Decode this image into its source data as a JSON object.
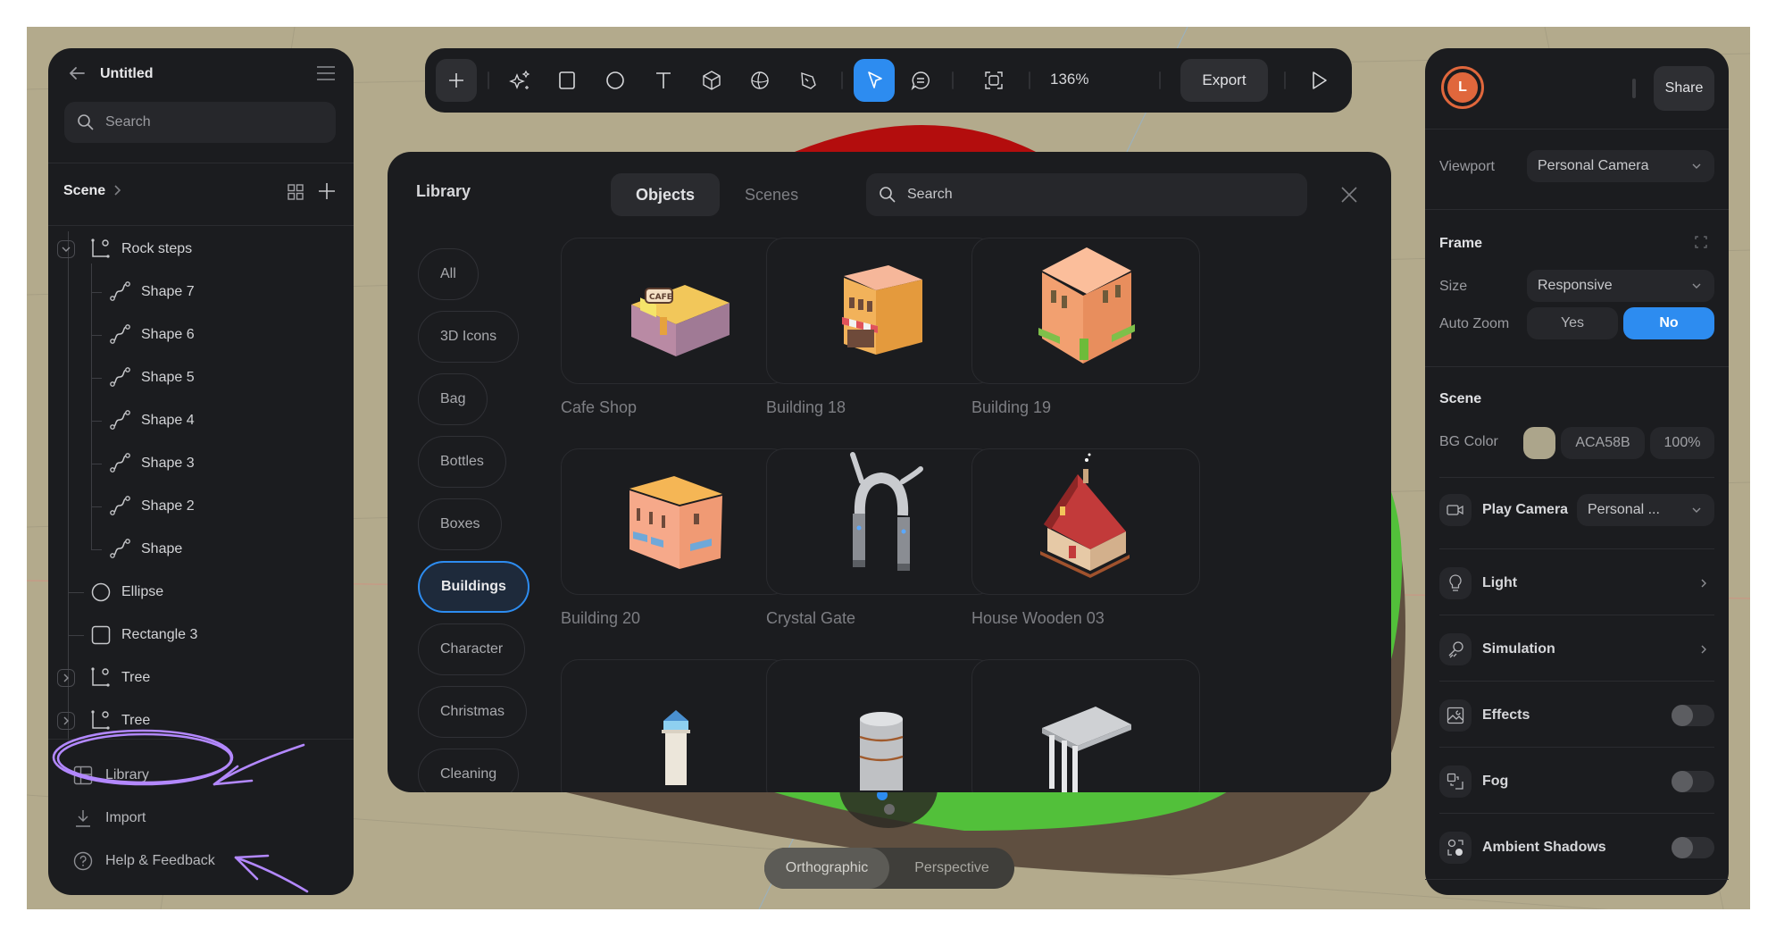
{
  "document": {
    "title": "Untitled"
  },
  "left_panel": {
    "search_placeholder": "Search",
    "scene_label": "Scene",
    "tree": [
      {
        "label": "Rock steps",
        "icon": "group-icon",
        "depth": 0,
        "toggle": "expanded"
      },
      {
        "label": "Shape 7",
        "icon": "path-shape-icon",
        "depth": 1
      },
      {
        "label": "Shape 6",
        "icon": "path-shape-icon",
        "depth": 1
      },
      {
        "label": "Shape 5",
        "icon": "path-shape-icon",
        "depth": 1
      },
      {
        "label": "Shape 4",
        "icon": "path-shape-icon",
        "depth": 1
      },
      {
        "label": "Shape 3",
        "icon": "path-shape-icon",
        "depth": 1
      },
      {
        "label": "Shape 2",
        "icon": "path-shape-icon",
        "depth": 1
      },
      {
        "label": "Shape",
        "icon": "path-shape-icon",
        "depth": 1
      },
      {
        "label": "Ellipse",
        "icon": "ellipse-icon",
        "depth": 0
      },
      {
        "label": "Rectangle 3",
        "icon": "rectangle-icon",
        "depth": 0
      },
      {
        "label": "Tree",
        "icon": "group-icon",
        "depth": 0,
        "toggle": "collapsed"
      },
      {
        "label": "Tree",
        "icon": "group-icon",
        "depth": 0,
        "toggle": "collapsed"
      }
    ],
    "footer": [
      {
        "label": "Library",
        "icon": "library-icon"
      },
      {
        "label": "Import",
        "icon": "import-icon"
      },
      {
        "label": "Help & Feedback",
        "icon": "help-icon"
      }
    ],
    "annotation": {
      "color": "#b388ff",
      "target": "Library"
    }
  },
  "toolbar": {
    "tools": [
      {
        "name": "add",
        "icon": "plus-icon"
      },
      {
        "name": "ai-generate",
        "icon": "sparkles-icon"
      },
      {
        "name": "rectangle",
        "icon": "rectangle-icon"
      },
      {
        "name": "ellipse",
        "icon": "ellipse-icon"
      },
      {
        "name": "text",
        "icon": "text-icon"
      },
      {
        "name": "cube",
        "icon": "cube-icon"
      },
      {
        "name": "sphere",
        "icon": "sphere-icon"
      },
      {
        "name": "pen",
        "icon": "pen-icon"
      },
      {
        "name": "select",
        "icon": "pointer-icon",
        "active": true
      },
      {
        "name": "comment",
        "icon": "comment-icon"
      },
      {
        "name": "frame",
        "icon": "frame-icon"
      }
    ],
    "zoom": "136%",
    "export_label": "Export",
    "play_icon": "play-icon",
    "accent": "#2d8cf0"
  },
  "library": {
    "title": "Library",
    "tabs": [
      {
        "label": "Objects",
        "active": true
      },
      {
        "label": "Scenes",
        "active": false
      }
    ],
    "search_placeholder": "Search",
    "categories": [
      {
        "label": "All"
      },
      {
        "label": "3D Icons"
      },
      {
        "label": "Bag"
      },
      {
        "label": "Bottles"
      },
      {
        "label": "Boxes"
      },
      {
        "label": "Buildings",
        "active": true
      },
      {
        "label": "Character"
      },
      {
        "label": "Christmas"
      },
      {
        "label": "Cleaning"
      }
    ],
    "breadcrumb": "Buildings",
    "items": [
      {
        "label": "Cafe Shop",
        "thumb": "cafe-shop"
      },
      {
        "label": "Building 18",
        "thumb": "building-18"
      },
      {
        "label": "Building 19",
        "thumb": "building-19"
      },
      {
        "label": "Building 20",
        "thumb": "building-20"
      },
      {
        "label": "Crystal Gate",
        "thumb": "crystal-gate"
      },
      {
        "label": "House Wooden 03",
        "thumb": "house-wooden-03"
      },
      {
        "label": "",
        "thumb": "lighthouse"
      },
      {
        "label": "",
        "thumb": "water-tower"
      },
      {
        "label": "",
        "thumb": "temple"
      }
    ]
  },
  "right_panel": {
    "avatar_initial": "L",
    "avatar_color": "#e0673c",
    "share_label": "Share",
    "viewport": {
      "label": "Viewport",
      "value": "Personal Camera"
    },
    "frame": {
      "title": "Frame",
      "size_label": "Size",
      "size_value": "Responsive",
      "auto_zoom_label": "Auto Zoom",
      "auto_zoom_options": [
        "Yes",
        "No"
      ],
      "auto_zoom_selected": "No"
    },
    "scene": {
      "title": "Scene",
      "bg_color_label": "BG Color",
      "bg_color_hex": "ACA58B",
      "bg_color_swatch": "#aca58b",
      "bg_opacity": "100%"
    },
    "play_camera": {
      "label": "Play Camera",
      "value": "Personal ..."
    },
    "rows": [
      {
        "label": "Light",
        "icon": "bulb-icon",
        "control": "chevron"
      },
      {
        "label": "Simulation",
        "icon": "simulation-icon",
        "control": "chevron"
      },
      {
        "label": "Effects",
        "icon": "image-effects-icon",
        "control": "toggle",
        "on": false
      },
      {
        "label": "Fog",
        "icon": "fog-icon",
        "control": "toggle",
        "on": false
      },
      {
        "label": "Ambient Shadows",
        "icon": "ambient-shadows-icon",
        "control": "toggle",
        "on": false
      }
    ]
  },
  "projection": {
    "options": [
      "Orthographic",
      "Perspective"
    ],
    "selected": "Orthographic"
  }
}
